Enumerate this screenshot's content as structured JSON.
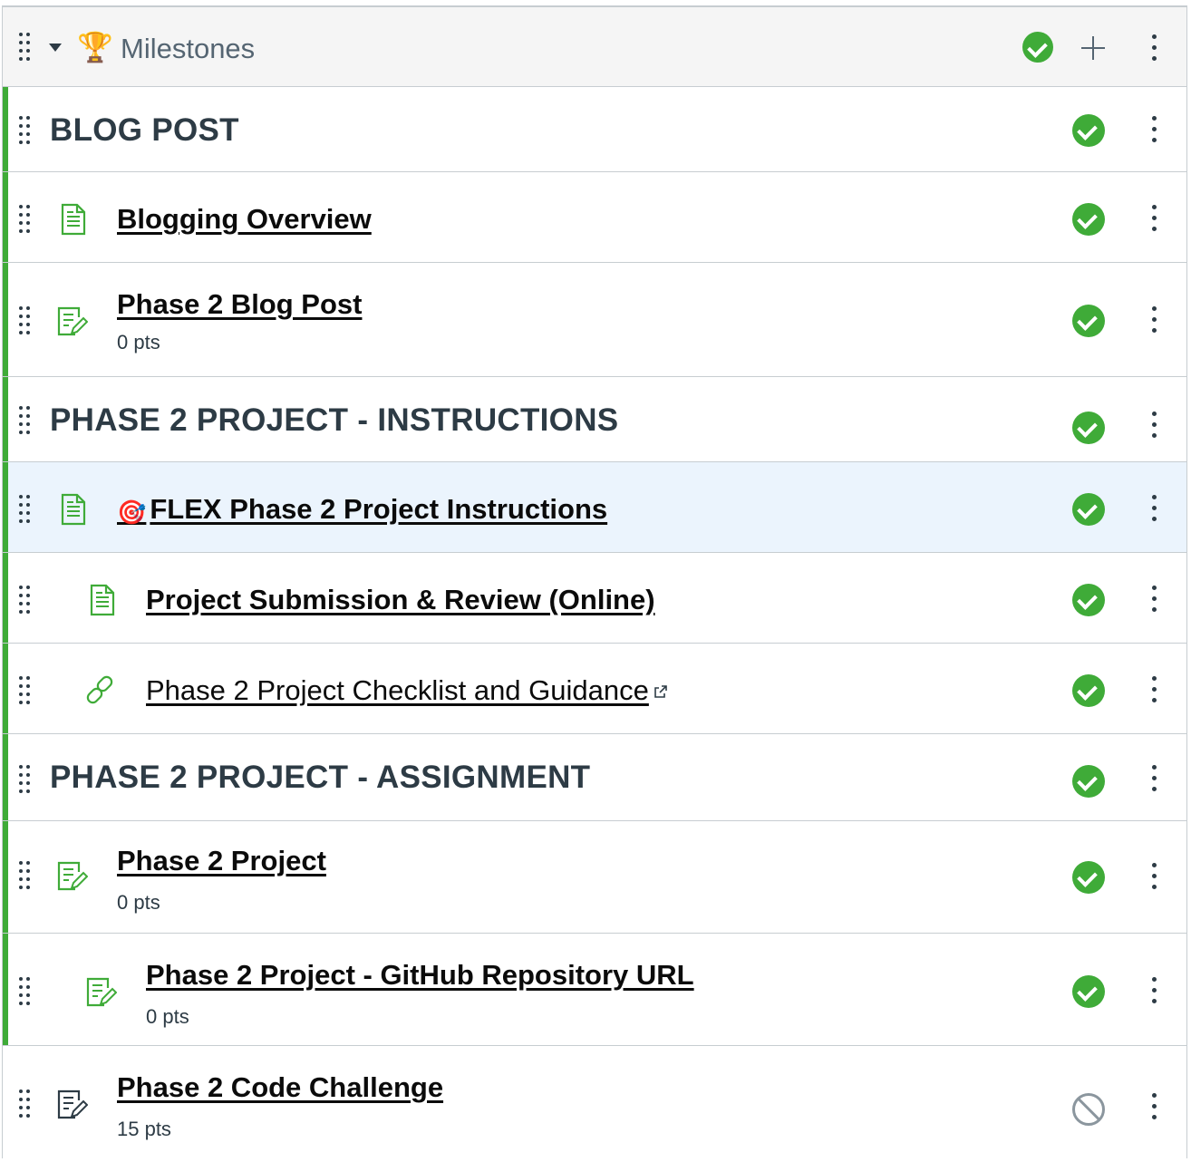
{
  "module": {
    "title": "Milestones",
    "icon": "trophy-icon",
    "status": "published"
  },
  "colors": {
    "published_green": "#3fab38",
    "highlight_bg": "#ebf4fd",
    "text": "#2d3b45"
  },
  "items": [
    {
      "type": "subheader",
      "title": "BLOG POST",
      "status": "published"
    },
    {
      "type": "page",
      "icon": "document-icon",
      "title": "Blogging Overview",
      "status": "published"
    },
    {
      "type": "assignment",
      "icon": "assignment-icon",
      "title": "Phase 2 Blog Post",
      "points": "0 pts",
      "status": "published"
    },
    {
      "type": "subheader",
      "title": "PHASE 2 PROJECT - INSTRUCTIONS",
      "status": "published"
    },
    {
      "type": "page",
      "icon": "document-icon",
      "prefix_icon": "target-icon",
      "prefix_glyph": "🎯",
      "title": "FLEX Phase 2 Project Instructions",
      "status": "published"
    },
    {
      "type": "page",
      "icon": "document-icon",
      "title": "Project Submission & Review (Online)",
      "status": "published"
    },
    {
      "type": "external-link",
      "icon": "link-icon",
      "title": "Phase 2 Project Checklist and Guidance",
      "status": "published"
    },
    {
      "type": "subheader",
      "title": "PHASE 2 PROJECT - ASSIGNMENT",
      "status": "published"
    },
    {
      "type": "assignment",
      "icon": "assignment-icon",
      "title": "Phase 2 Project",
      "points": "0 pts",
      "status": "published"
    },
    {
      "type": "assignment",
      "icon": "assignment-icon",
      "title": "Phase 2 Project - GitHub Repository URL",
      "points": "0 pts",
      "status": "published"
    },
    {
      "type": "assignment",
      "icon": "assignment-icon",
      "title": "Phase 2 Code Challenge",
      "points": "15 pts",
      "status": "unpublished"
    }
  ]
}
